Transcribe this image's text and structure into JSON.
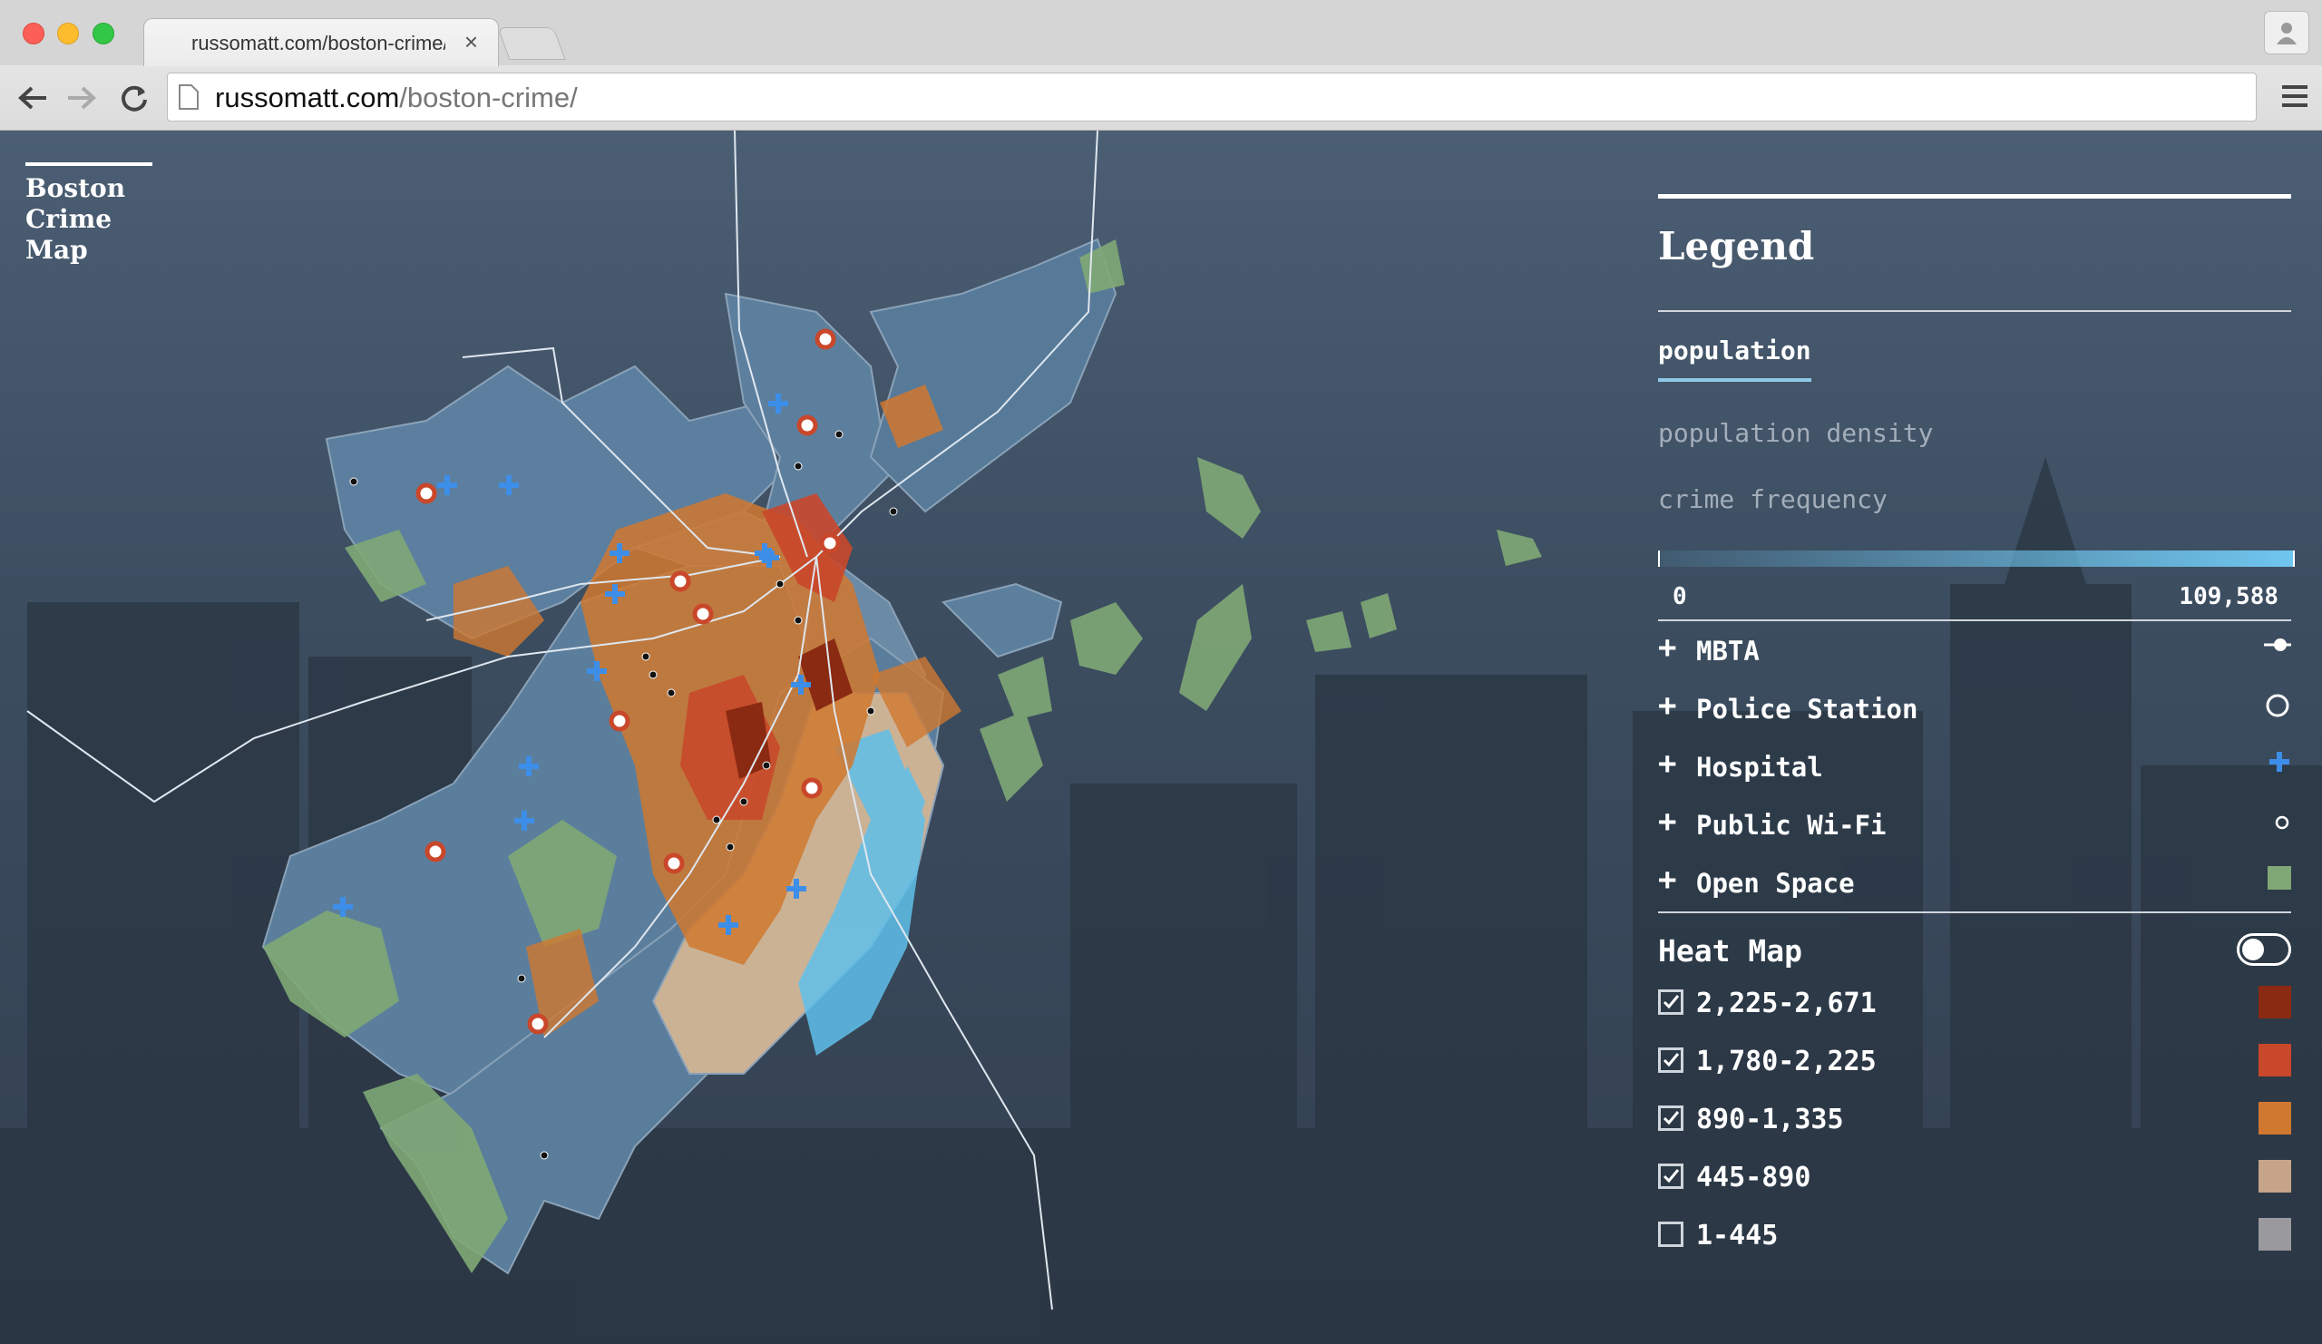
{
  "browser": {
    "tab_title": "russomatt.com/boston-crime/",
    "tab_close": "×",
    "url_domain": "russomatt.com",
    "url_path": "/boston-crime/"
  },
  "brand": {
    "line1": "Boston",
    "line2": "Crime",
    "line3": "Map"
  },
  "legend": {
    "title": "Legend",
    "active_tab": "population",
    "options": [
      "population density",
      "crime frequency"
    ],
    "scale_min": "0",
    "scale_max": "109,588",
    "layers": [
      {
        "label": "MBTA",
        "icon": "mbta-line-icon"
      },
      {
        "label": "Police Station",
        "icon": "police-circle-icon"
      },
      {
        "label": "Hospital",
        "icon": "hospital-cross-icon"
      },
      {
        "label": "Public Wi-Fi",
        "icon": "wifi-dot-icon"
      },
      {
        "label": "Open Space",
        "icon": "open-space-swatch",
        "color": "#7fa876"
      }
    ],
    "heat_map": {
      "title": "Heat Map",
      "enabled": false,
      "ranges": [
        {
          "label": "2,225-2,671",
          "checked": true,
          "color": "#8b2a12"
        },
        {
          "label": "1,780-2,225",
          "checked": true,
          "color": "#c9472a"
        },
        {
          "label": "890-1,335",
          "checked": true,
          "color": "#d0782f"
        },
        {
          "label": "445-890",
          "checked": true,
          "color": "#c6a487"
        },
        {
          "label": "1-445",
          "checked": false,
          "color": "#9a9a9e"
        }
      ]
    }
  },
  "colors": {
    "water": "#5fc0ea",
    "open_space": "#7fa876",
    "hospital": "#3d8ee8",
    "district": "#5c7f9f"
  }
}
